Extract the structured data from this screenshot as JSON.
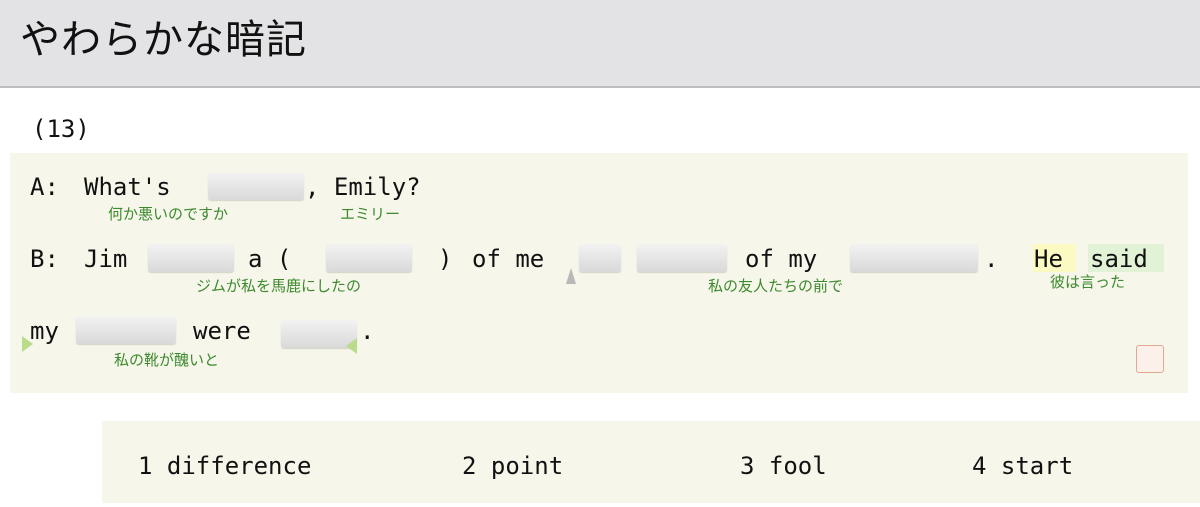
{
  "app": {
    "title": "やわらかな暗記"
  },
  "question": {
    "number": "(13)"
  },
  "dialogue": {
    "line_a": {
      "speaker": "A:",
      "word1": "What's",
      "word2": ", Emily?",
      "gloss1": "何か悪いのですか",
      "gloss2": "エミリー"
    },
    "line_b": {
      "speaker": "B:",
      "word_jim": "Jim",
      "word_a_paren": "a (",
      "word_close_paren": ")",
      "word_of_me": "of me",
      "word_of_my": "of my",
      "word_period": ".",
      "word_he": "He",
      "word_said": "said",
      "gloss1": "ジムが私を馬鹿にしたの",
      "gloss2": "私の友人たちの前で",
      "gloss3": "彼は言った"
    },
    "line_c": {
      "word_my": "my",
      "word_were": "were",
      "word_period": ".",
      "gloss1": "私の靴が醜いと"
    }
  },
  "choices": [
    {
      "label": "1 difference"
    },
    {
      "label": "2 point"
    },
    {
      "label": "3 fool"
    },
    {
      "label": "4 start"
    }
  ],
  "colors": {
    "header_bg": "#e3e3e5",
    "panel_bg": "#f6f6ea",
    "gloss_text": "#3d8a2e",
    "highlight_yellow": "#fafac2",
    "highlight_green": "#e2f2d6",
    "marker_green": "#b9dc8a"
  }
}
